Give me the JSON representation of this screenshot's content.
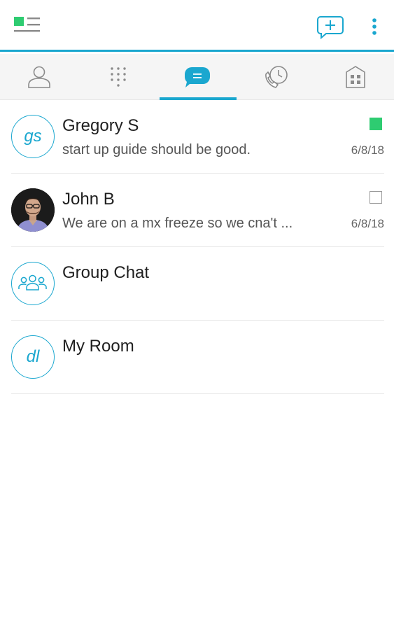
{
  "colors": {
    "accent": "#1aa7cf",
    "presence_green": "#2ecc71",
    "tab_bar_bg": "#f5f5f5",
    "icon_gray": "#8a8a8a"
  },
  "topbar": {
    "menu_icon": "menu-status-icon",
    "compose_icon": "new-chat-icon",
    "more_icon": "more-vert-icon"
  },
  "tabs": [
    {
      "id": "contacts",
      "icon": "person-icon",
      "active": false
    },
    {
      "id": "dialpad",
      "icon": "dialpad-icon",
      "active": false
    },
    {
      "id": "chat",
      "icon": "chat-bubble-icon",
      "active": true
    },
    {
      "id": "history",
      "icon": "call-history-icon",
      "active": false
    },
    {
      "id": "directory",
      "icon": "building-icon",
      "active": false
    }
  ],
  "conversations": [
    {
      "name": "Gregory S",
      "snippet": "start up guide should be good.",
      "date": "6/8/18",
      "avatar": {
        "type": "initials",
        "text": "gs"
      },
      "flag": "green"
    },
    {
      "name": "John B",
      "snippet": "We are on a mx freeze so we cna't ...",
      "date": "6/8/18",
      "avatar": {
        "type": "photo"
      },
      "flag": "empty"
    },
    {
      "name": "Group Chat",
      "snippet": "",
      "date": "",
      "avatar": {
        "type": "group-icon"
      },
      "flag": "none"
    },
    {
      "name": "My Room",
      "snippet": "",
      "date": "",
      "avatar": {
        "type": "initials",
        "text": "dl"
      },
      "flag": "none"
    }
  ]
}
